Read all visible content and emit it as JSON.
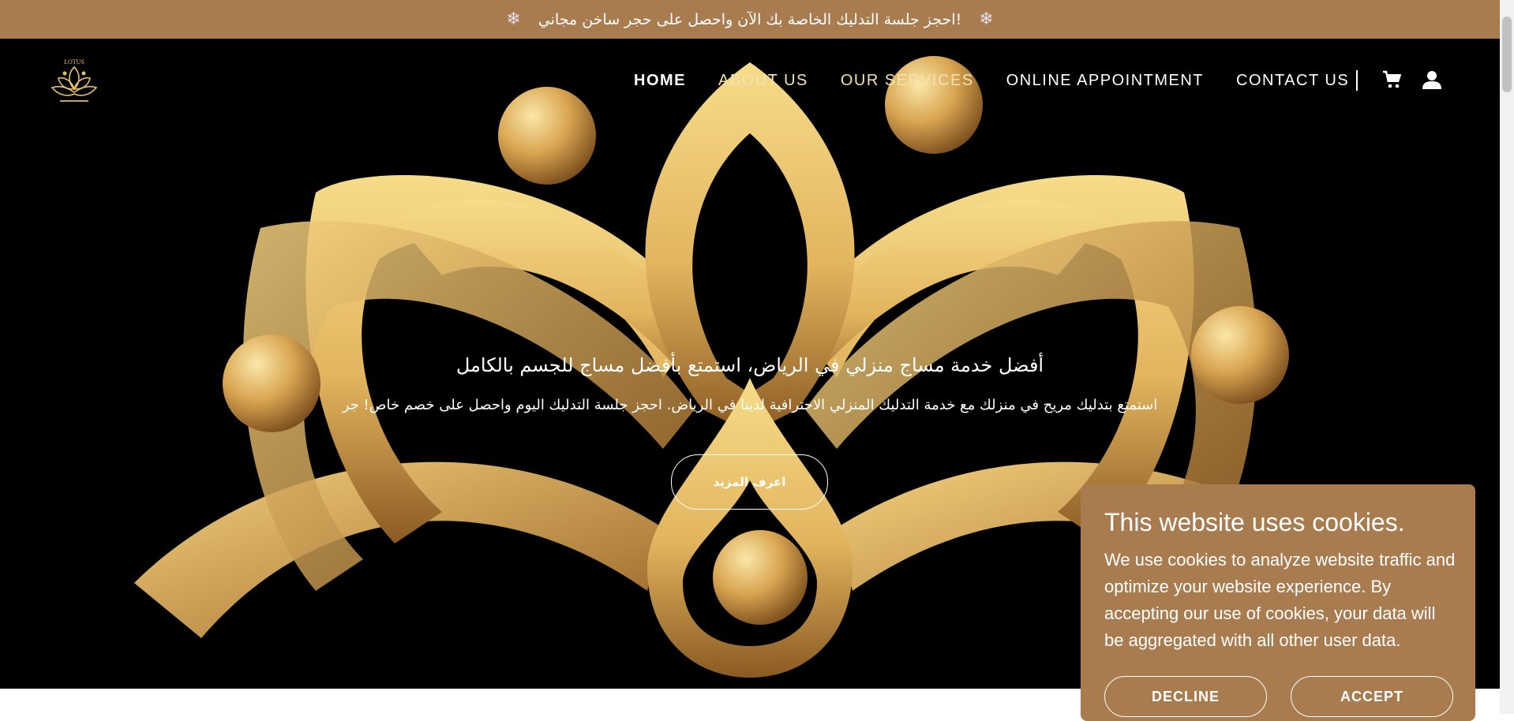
{
  "announcement": {
    "text": "!احجز جلسة التدليك الخاصة بك الآن واحصل على حجر ساخن مجاني",
    "left_icon": "snowflake-icon",
    "right_icon": "snowflake-icon"
  },
  "header": {
    "logo_text": "LOTUS",
    "nav": [
      {
        "label": "HOME"
      },
      {
        "label": "ABOUT US"
      },
      {
        "label": "OUR SERVICES"
      },
      {
        "label": "ONLINE APPOINTMENT"
      },
      {
        "label": "CONTACT US"
      }
    ],
    "icons": [
      "cart-icon",
      "user-icon"
    ]
  },
  "hero": {
    "title": "أفضل خدمة مساج منزلي في الرياض، استمتع بأفضل مساج للجسم بالكامل",
    "subtitle": "استمتع بتدليك مريح في منزلك مع خدمة التدليك المنزلي الاحترافية لدينا في الرياض. احجز جلسة التدليك اليوم واحصل على خصم خاص! جر",
    "button": "اعرف المزيد"
  },
  "cookie_banner": {
    "title": "This website uses cookies.",
    "body": "We use cookies to analyze website traffic and optimize your website experience. By accepting our use of cookies, your data will be aggregated with all other user data.",
    "decline": "DECLINE",
    "accept": "ACCEPT"
  },
  "colors": {
    "brand": "#a87c4f",
    "gold": "#e8c06a",
    "hero_bg": "#000000"
  }
}
